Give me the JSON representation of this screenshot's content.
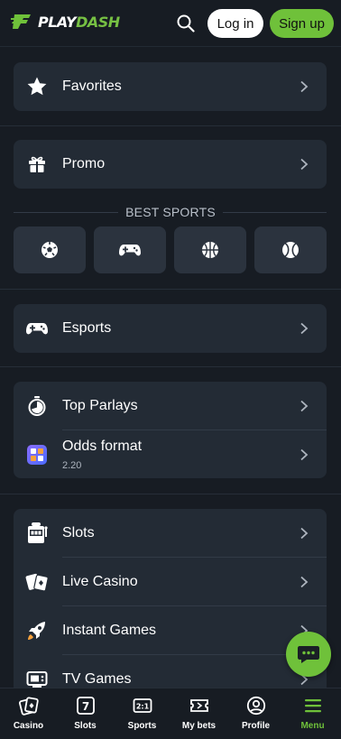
{
  "brand": {
    "name_part1": "PLAY",
    "name_part2": "DASH",
    "accent": "#6fc13a"
  },
  "header": {
    "login_label": "Log in",
    "signup_label": "Sign up",
    "search_icon": "search-icon"
  },
  "menu": {
    "favorites": {
      "label": "Favorites",
      "icon": "star-icon"
    },
    "promo": {
      "label": "Promo",
      "icon": "gift-icon"
    },
    "best_sports": {
      "title": "BEST SPORTS",
      "items": [
        {
          "icon": "soccer-ball-icon"
        },
        {
          "icon": "gamepad-icon"
        },
        {
          "icon": "basketball-icon"
        },
        {
          "icon": "tennis-ball-icon"
        }
      ]
    },
    "esports": {
      "label": "Esports",
      "icon": "gamepad-icon"
    },
    "top_parlays": {
      "label": "Top Parlays",
      "icon": "stopwatch-icon"
    },
    "odds_format": {
      "label": "Odds format",
      "value": "2.20",
      "icon": "odds-grid-icon"
    },
    "games": [
      {
        "label": "Slots",
        "icon": "slot-machine-icon"
      },
      {
        "label": "Live Casino",
        "icon": "cards-icon"
      },
      {
        "label": "Instant Games",
        "icon": "rocket-icon"
      },
      {
        "label": "TV Games",
        "icon": "tv-icon"
      }
    ]
  },
  "bottom_nav": [
    {
      "label": "Casino",
      "icon": "casino-icon"
    },
    {
      "label": "Slots",
      "icon": "slots-icon"
    },
    {
      "label": "Sports",
      "icon": "sports-icon"
    },
    {
      "label": "My bets",
      "icon": "ticket-icon"
    },
    {
      "label": "Profile",
      "icon": "profile-icon"
    },
    {
      "label": "Menu",
      "icon": "menu-icon",
      "active": true
    }
  ],
  "chat": {
    "icon": "chat-icon"
  }
}
